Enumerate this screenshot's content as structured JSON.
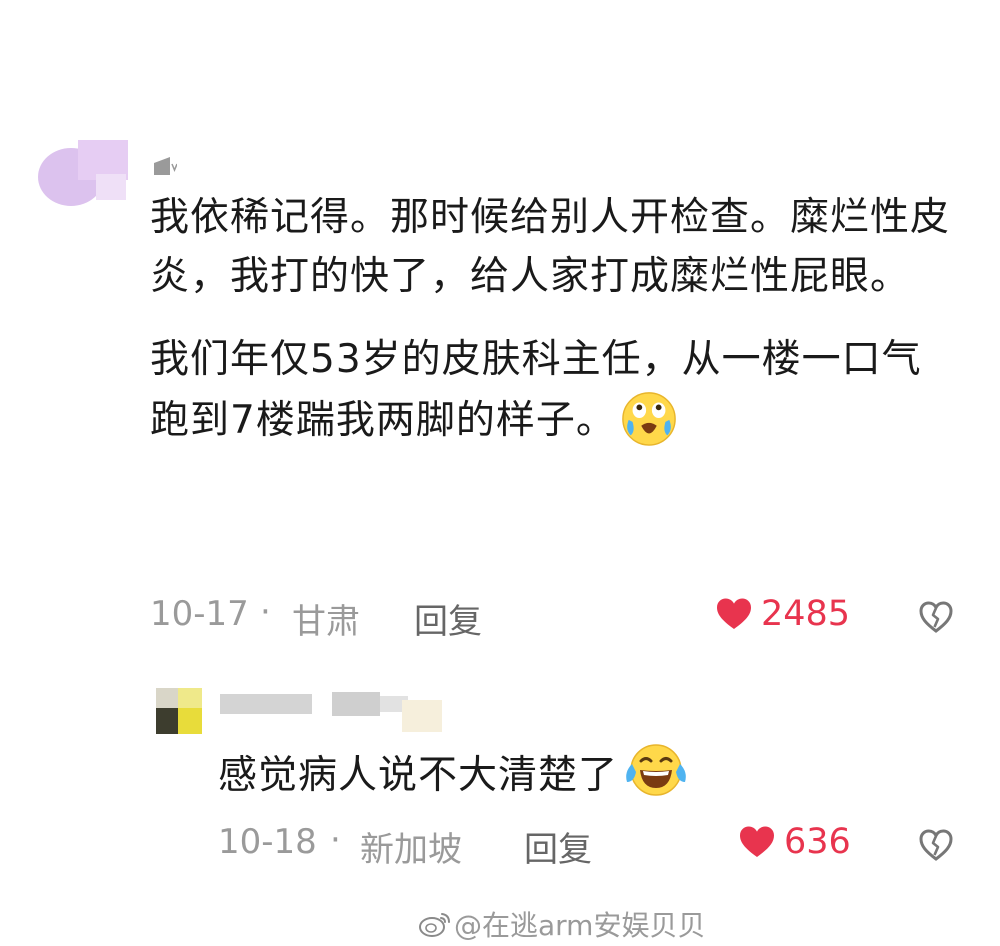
{
  "main_comment": {
    "paragraphs": [
      "我依稀记得。那时候给别人开检查。糜烂性皮炎，我打的快了，给人家打成糜烂性屁眼。",
      "我们年仅53岁的皮肤科主任，从一楼一口气跑到7楼踹我两脚的样子。"
    ],
    "emoji": "laugh-cry-emoji",
    "date": "10-17",
    "separator": "·",
    "location": "甘肃",
    "reply_label": "回复",
    "like_count": "2485"
  },
  "reply_comment": {
    "text": "感觉病人说不大清楚了",
    "emoji": "laugh-tears-emoji",
    "date": "10-18",
    "separator": "·",
    "location": "新加坡",
    "reply_label": "回复",
    "like_count": "636"
  },
  "icons": {
    "like": "heart-icon",
    "dislike": "broken-heart-icon",
    "watermark": "weibo-icon"
  },
  "colors": {
    "like": "#e8344e",
    "meta_text": "#9a9a9a",
    "body_text": "#1a1a1a"
  },
  "watermark": {
    "text": "@在逃arm安娱贝贝"
  }
}
